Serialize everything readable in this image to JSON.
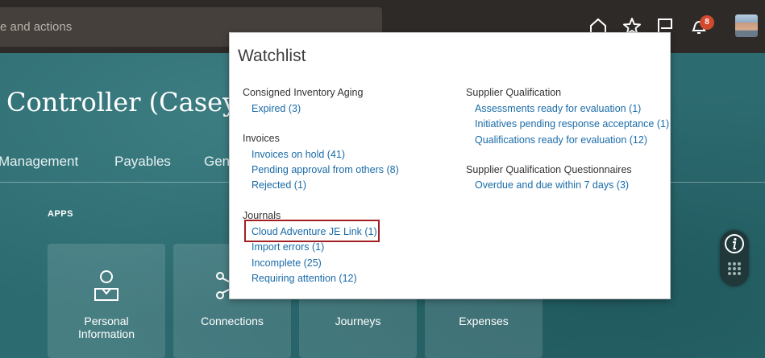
{
  "search": {
    "placeholder_fragment": "e and actions"
  },
  "notifications": {
    "count": "8"
  },
  "page": {
    "title": "Controller (Casey",
    "nav": [
      "Management",
      "Payables",
      "Gen"
    ],
    "apps_label": "APPS",
    "tiles": [
      {
        "label_line1": "Personal",
        "label_line2": "Information",
        "icon": "person-icon"
      },
      {
        "label_line1": "Connections",
        "label_line2": "",
        "icon": "connections-icon"
      },
      {
        "label_line1": "Journeys",
        "label_line2": "",
        "icon": "journeys-icon"
      },
      {
        "label_line1": "Expenses",
        "label_line2": "",
        "icon": "expenses-icon"
      }
    ]
  },
  "watchlist": {
    "title": "Watchlist",
    "left": [
      {
        "heading": "Consigned Inventory Aging",
        "items": [
          "Expired (3)"
        ]
      },
      {
        "heading": "Invoices",
        "items": [
          "Invoices on hold (41)",
          "Pending approval from others (8)",
          "Rejected (1)"
        ]
      },
      {
        "heading": "Journals",
        "items": [
          "Cloud Adventure JE Link (1)",
          "Import errors (1)",
          "Incomplete (25)",
          "Requiring attention (12)"
        ]
      }
    ],
    "right": [
      {
        "heading": "Supplier Qualification",
        "items": [
          "Assessments ready for evaluation (1)",
          "Initiatives pending response acceptance (1)",
          "Qualifications ready for evaluation (12)"
        ]
      },
      {
        "heading": "Supplier Qualification Questionnaires",
        "items": [
          "Overdue and due within 7 days (3)"
        ]
      }
    ]
  },
  "colors": {
    "link": "#1a6ba8",
    "highlight": "#a31f24",
    "teal": "#2c6b70",
    "topbar": "#2e2a28"
  }
}
